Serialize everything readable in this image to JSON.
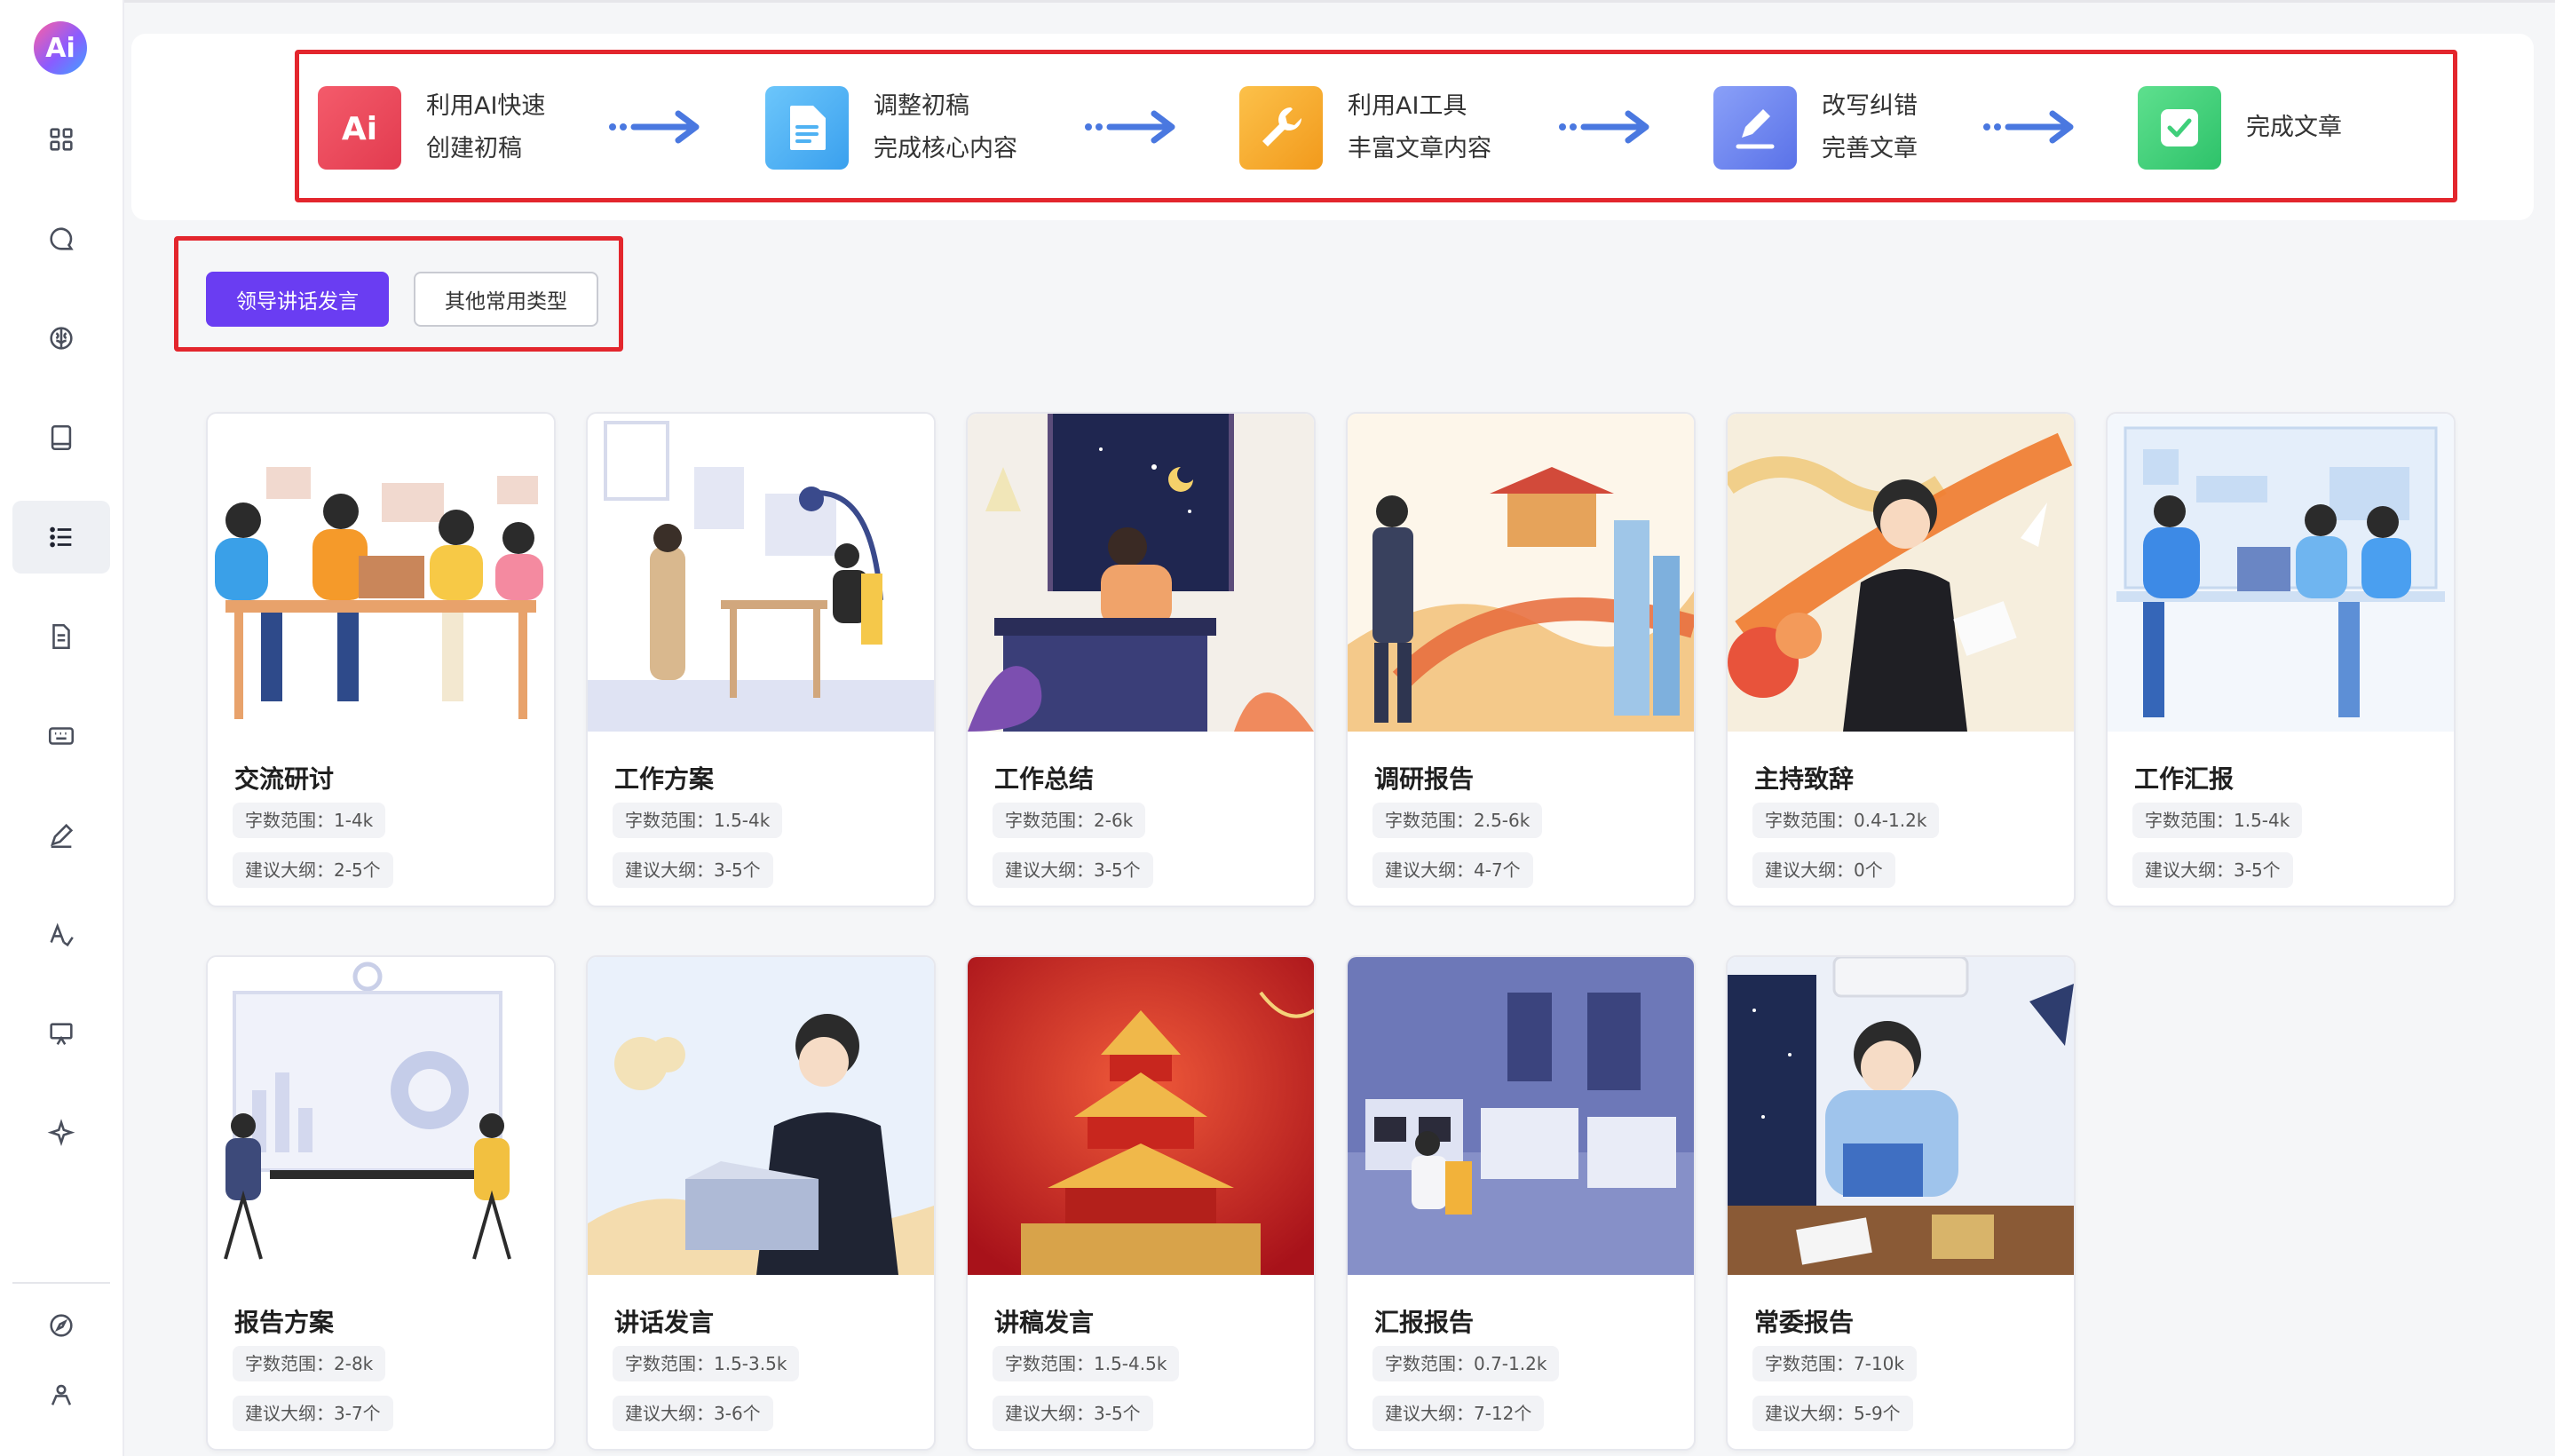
{
  "app": {
    "logo_text": "Ai"
  },
  "sidebar": {
    "items": [
      {
        "name": "grid-icon"
      },
      {
        "name": "chat-icon"
      },
      {
        "name": "brain-icon"
      },
      {
        "name": "book-icon"
      },
      {
        "name": "list-icon",
        "active": true
      },
      {
        "name": "document-icon"
      },
      {
        "name": "keyboard-icon"
      },
      {
        "name": "pen-icon"
      },
      {
        "name": "translate-icon"
      },
      {
        "name": "presentation-icon"
      },
      {
        "name": "sparkle-icon"
      }
    ],
    "bottom_items": [
      {
        "name": "compass-icon"
      },
      {
        "name": "user-icon"
      }
    ]
  },
  "steps": [
    {
      "icon": "ai-icon",
      "color": "#ee4b5a",
      "line1": "利用AI快速",
      "line2": "创建初稿"
    },
    {
      "icon": "file-icon",
      "color": "#4fb2f3",
      "line1": "调整初稿",
      "line2": "完成核心内容"
    },
    {
      "icon": "wrench-icon",
      "color": "#f5a623",
      "line1": "利用AI工具",
      "line2": "丰富文章内容"
    },
    {
      "icon": "edit-icon",
      "color": "#6f86f0",
      "line1": "改写纠错",
      "line2": "完善文章"
    },
    {
      "icon": "check-icon",
      "color": "#3fcf7a",
      "line1": "完成文章",
      "line2": ""
    }
  ],
  "tabs": {
    "active": "领导讲话发言",
    "other": "其他常用类型"
  },
  "cards": [
    {
      "title": "交流研讨",
      "range": "字数范围：1-4k",
      "outline": "建议大纲：2-5个"
    },
    {
      "title": "工作方案",
      "range": "字数范围：1.5-4k",
      "outline": "建议大纲：3-5个"
    },
    {
      "title": "工作总结",
      "range": "字数范围：2-6k",
      "outline": "建议大纲：3-5个"
    },
    {
      "title": "调研报告",
      "range": "字数范围：2.5-6k",
      "outline": "建议大纲：4-7个"
    },
    {
      "title": "主持致辞",
      "range": "字数范围：0.4-1.2k",
      "outline": "建议大纲：0个"
    },
    {
      "title": "工作汇报",
      "range": "字数范围：1.5-4k",
      "outline": "建议大纲：3-5个"
    },
    {
      "title": "报告方案",
      "range": "字数范围：2-8k",
      "outline": "建议大纲：3-7个"
    },
    {
      "title": "讲话发言",
      "range": "字数范围：1.5-3.5k",
      "outline": "建议大纲：3-6个"
    },
    {
      "title": "讲稿发言",
      "range": "字数范围：1.5-4.5k",
      "outline": "建议大纲：3-5个"
    },
    {
      "title": "汇报报告",
      "range": "字数范围：0.7-1.2k",
      "outline": "建议大纲：7-12个"
    },
    {
      "title": "常委报告",
      "range": "字数范围：7-10k",
      "outline": "建议大纲：5-9个"
    }
  ],
  "colors": {
    "accent": "#6a3df2",
    "highlight_frame": "#e3262d",
    "arrow": "#4a78e0"
  }
}
